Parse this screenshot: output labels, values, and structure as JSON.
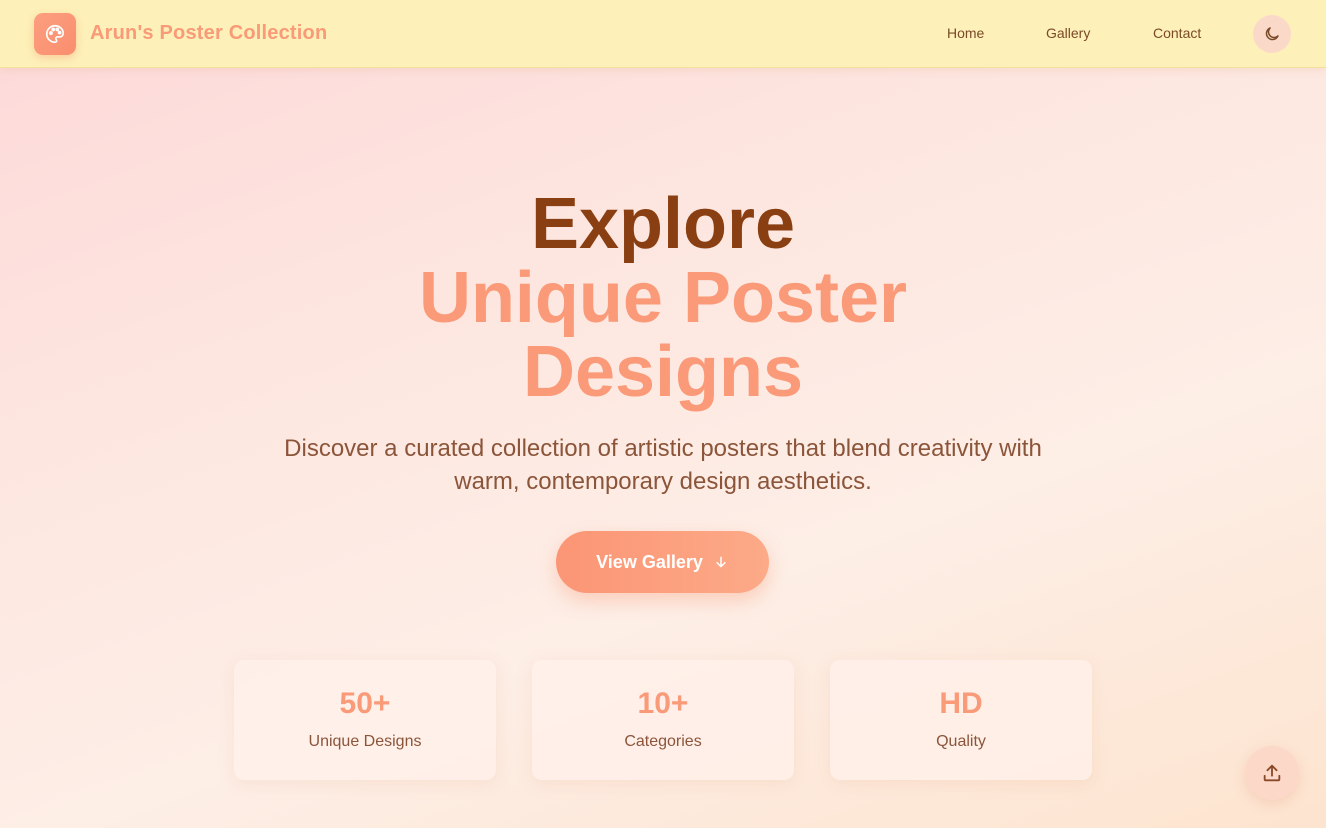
{
  "nav": {
    "brand": "Arun's Poster Collection",
    "links": [
      "Home",
      "Gallery",
      "Contact"
    ],
    "logo_icon": "palette-icon",
    "theme_icon": "moon-icon"
  },
  "hero": {
    "title_line1": "Explore",
    "title_line2": "Unique Poster",
    "title_line3": "Designs",
    "subtitle": "Discover a curated collection of artistic posters that blend creativity with warm, contemporary design aesthetics.",
    "cta_label": "View Gallery",
    "cta_icon": "arrow-down-icon"
  },
  "stats": [
    {
      "value": "50+",
      "label": "Unique Designs"
    },
    {
      "value": "10+",
      "label": "Categories"
    },
    {
      "value": "HD",
      "label": "Quality"
    }
  ],
  "fab": {
    "icon": "upload-icon"
  },
  "colors": {
    "accent": "#fa9a78",
    "title_dark": "#8a3f12",
    "nav_bg": "#fdf0b8",
    "text": "#8b553a"
  }
}
